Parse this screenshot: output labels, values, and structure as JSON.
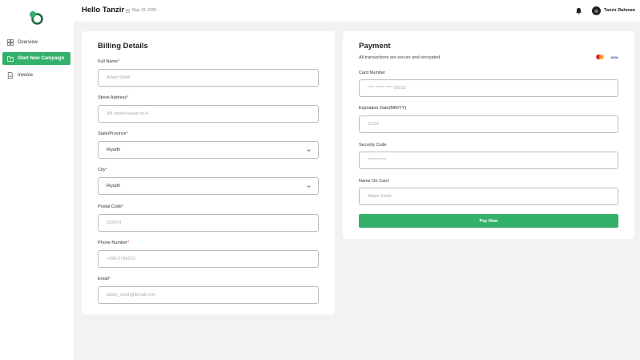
{
  "header": {
    "greeting": "Hello Tanzir",
    "date": "May 19, 2025",
    "user_name": "Tanzir Rahman"
  },
  "sidebar": {
    "items": [
      {
        "label": "Overview",
        "icon": "grid-icon"
      },
      {
        "label": "Start New Campaign",
        "icon": "campaign-icon"
      },
      {
        "label": "Invoice",
        "icon": "document-icon"
      }
    ]
  },
  "billing": {
    "title": "Billing Details",
    "full_name": {
      "label": "Full Name",
      "placeholder": "Adam Smith"
    },
    "street": {
      "label": "Street Address",
      "placeholder": "3/4 street-house no.4"
    },
    "state": {
      "label": "State/Province",
      "value": "Riyadh"
    },
    "city": {
      "label": "City",
      "value": "Riyadh"
    },
    "postal": {
      "label": "Postal Code",
      "placeholder": "332874"
    },
    "phone": {
      "label": "Phone Number",
      "placeholder": "+998-2769223"
    },
    "email": {
      "label": "Email",
      "placeholder": "adam_smith@Email.com"
    },
    "required_mark": "*"
  },
  "payment": {
    "title": "Payment",
    "subtitle": "All transactions are secure and encrypted",
    "card_number": {
      "label": "Card Number",
      "placeholder": "**** ***** **** 09232"
    },
    "expiration": {
      "label": "Expiration Date(MM/YY)",
      "placeholder": "12/24"
    },
    "security": {
      "label": "Security Code",
      "placeholder": "***********"
    },
    "name_on_card": {
      "label": "Name On Card",
      "placeholder": "Adam Smith"
    },
    "pay_button": "Pay Now",
    "visa": "VISA"
  },
  "colors": {
    "accent": "#33b06a",
    "background": "#f2f2f2",
    "required": "#dd3333"
  }
}
